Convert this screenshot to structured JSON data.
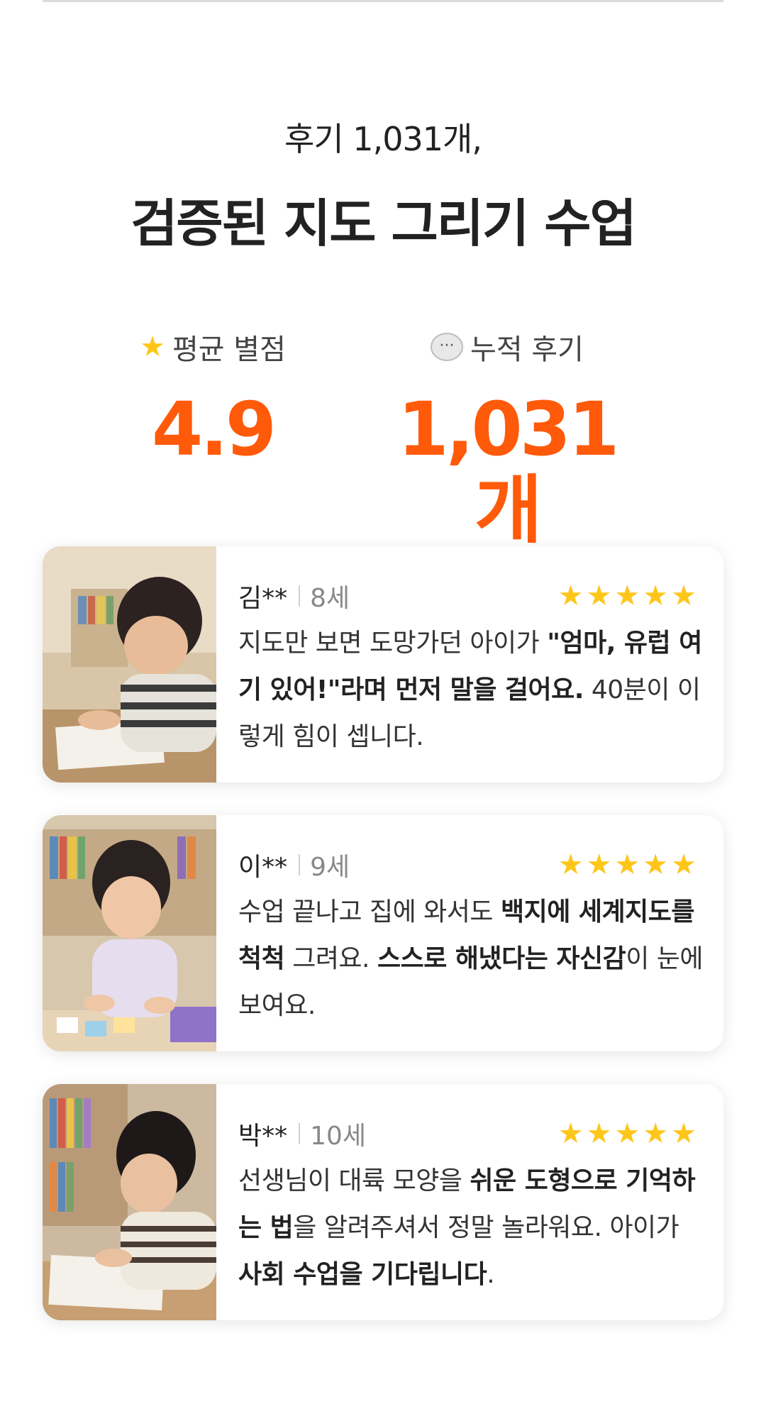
{
  "hero": {
    "subtitle": "후기 1,031개,",
    "title": "검증된 지도 그리기 수업"
  },
  "stats": {
    "rating": {
      "icon": "star-icon",
      "label": "평균 별점",
      "value": "4.9"
    },
    "reviews": {
      "icon": "speech-bubble-icon",
      "label": "누적 후기",
      "value": "1,031개"
    }
  },
  "colors": {
    "accent": "#ff5a0a",
    "star": "#ffc61a"
  },
  "reviews": [
    {
      "name": "김**",
      "age": "8세",
      "rating": 5,
      "text": [
        {
          "t": "지도만 보면 도망가던 아이가 ",
          "b": false
        },
        {
          "t": "\"엄마, 유럽 여기 있어!\"라며 먼저 말을 걸어요.",
          "b": true
        },
        {
          "t": " 40분이 이렇게 힘이 셉니다.",
          "b": false
        }
      ]
    },
    {
      "name": "이**",
      "age": "9세",
      "rating": 5,
      "text": [
        {
          "t": "수업 끝나고 집에 와서도 ",
          "b": false
        },
        {
          "t": "백지에 세계지도를 척척",
          "b": true
        },
        {
          "t": " 그려요. ",
          "b": false
        },
        {
          "t": "스스로 해냈다는 자신감",
          "b": true
        },
        {
          "t": "이 눈에 보여요.",
          "b": false
        }
      ]
    },
    {
      "name": "박**",
      "age": "10세",
      "rating": 5,
      "text": [
        {
          "t": "선생님이 대륙 모양을 ",
          "b": false
        },
        {
          "t": "쉬운 도형으로 기억하는 법",
          "b": true
        },
        {
          "t": "을 알려주셔서 정말 놀라워요. 아이가 ",
          "b": false
        },
        {
          "t": "사회 수업을 기다립니다",
          "b": true
        },
        {
          "t": ".",
          "b": false
        }
      ]
    }
  ]
}
